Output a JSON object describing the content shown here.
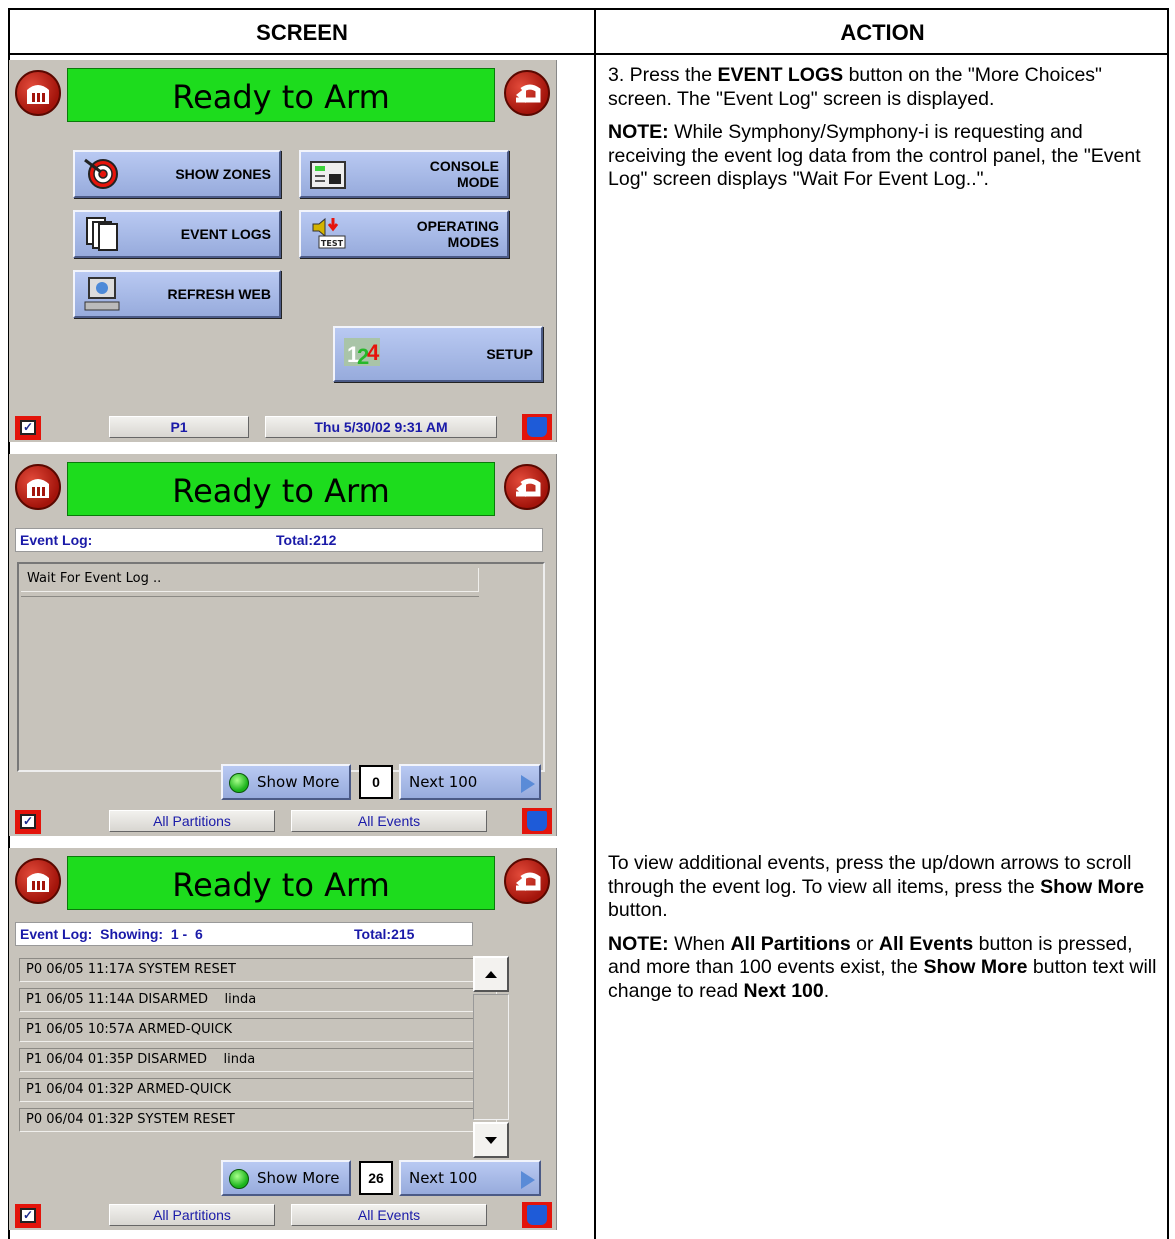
{
  "table": {
    "col_screen": "SCREEN",
    "col_action": "ACTION"
  },
  "screen1": {
    "title": "Ready to Arm",
    "buttons": {
      "show_zones": "SHOW ZONES",
      "console_mode_1": "CONSOLE",
      "console_mode_2": "MODE",
      "event_logs": "EVENT LOGS",
      "operating_modes_1": "OPERATING",
      "operating_modes_2": "MODES",
      "refresh_web": "REFRESH WEB",
      "setup": "SETUP"
    },
    "status": {
      "partition": "P1",
      "datetime": "Thu 5/30/02  9:31 AM"
    }
  },
  "screen2": {
    "title": "Ready to Arm",
    "log_label": "Event Log:",
    "total": "Total:212",
    "rows": [
      "Wait For Event Log .."
    ],
    "show_more": "Show More",
    "count": "0",
    "next": "Next 100",
    "status": {
      "partitions": "All Partitions",
      "events": "All Events"
    }
  },
  "screen3": {
    "title": "Ready to Arm",
    "log_label": "Event Log:  Showing:  1 -  6",
    "total": "Total:215",
    "rows": [
      "P0 06/05 11:17A SYSTEM RESET",
      "P1 06/05 11:14A DISARMED    linda",
      "P1 06/05 10:57A ARMED-QUICK",
      "P1 06/04 01:35P DISARMED    linda",
      "P1 06/04 01:32P ARMED-QUICK",
      "P0 06/04 01:32P SYSTEM RESET"
    ],
    "show_more": "Show More",
    "count": "26",
    "next": "Next 100",
    "status": {
      "partitions": "All Partitions",
      "events": "All Events"
    }
  },
  "action1": {
    "p1_pre": "3.  Press the ",
    "p1_bold": "EVENT LOGS",
    "p1_post": " button on the \"More Choices\" screen.  The \"Event Log\" screen is displayed.",
    "note_label": "NOTE:",
    "note_text": " While Symphony/Symphony-i is requesting and receiving the event log data from the control panel, the \"Event Log\" screen displays \"Wait For Event Log..\"."
  },
  "action2": {
    "p1_pre": "To view additional events, press the up/down arrows to scroll through the event log.  To view all items, press the ",
    "p1_bold": "Show More",
    "p1_post": " button.",
    "note_label": "NOTE:",
    "note_t1": "  When ",
    "note_b1": "All Partitions",
    "note_t2": " or ",
    "note_b2": "All Events",
    "note_t3": " button is pressed, and more than 100 events exist, the ",
    "note_b3": "Show More",
    "note_t4": " button text will change to read ",
    "note_b4": "Next 100",
    "note_t5": "."
  },
  "colors": {
    "green_bar": "#1ddc1d",
    "button_blue": "#a8bbea",
    "status_text": "#1a1aa8",
    "red_accent": "#e3140b"
  }
}
